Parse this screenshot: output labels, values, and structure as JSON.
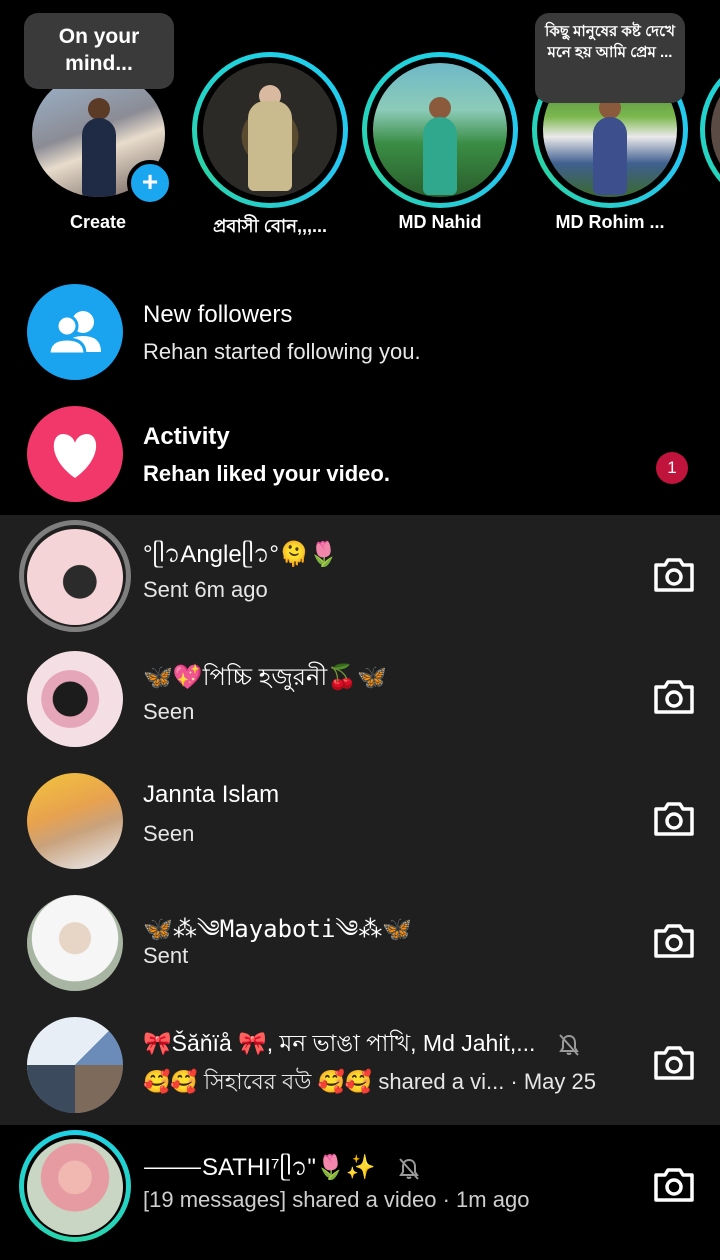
{
  "stories": [
    {
      "name": "Create",
      "bubble": "On your mind..."
    },
    {
      "name": "প্রবাসী বোন,,,..."
    },
    {
      "name": "MD Nahid"
    },
    {
      "name": "MD Rohim ...",
      "bubble": "কিছু মানুষের কষ্ট দেখে মনে হয় আমি প্রেম ..."
    }
  ],
  "notifications": [
    {
      "title": "New followers",
      "subtitle": "Rehan started following you.",
      "icon": "people-icon",
      "color": "#1aa3ef"
    },
    {
      "title": "Activity",
      "subtitle": "Rehan liked your video.",
      "icon": "heart-icon",
      "color": "#f2386b",
      "badge": "1"
    }
  ],
  "chats": [
    {
      "name": "°ᥫ᭡Angleᥫ᭡°🫠🌷",
      "meta": "Sent 6m ago"
    },
    {
      "name": "🦋💖পিচ্চি হজুরনী🍒🦋",
      "meta": "Seen"
    },
    {
      "name": "Jannta Islam",
      "meta": "Seen"
    },
    {
      "name": "🦋⁂༄Mayaboti༄⁂🦋",
      "meta": "Sent"
    },
    {
      "name": "🎀Šăňïå 🎀, মন ভাঙা পাখি, Md Jahit,...",
      "meta": "🥰🥰 সিহাবের বউ 🥰🥰 shared a vi... · May 25",
      "muted": true
    },
    {
      "name": "⸻SATHI⁷ᥫ᭡\"🌷✨",
      "meta": "[19 messages] shared a video · 1m ago",
      "muted": true
    }
  ],
  "colors": {
    "accent_blue": "#1aa7f0",
    "ring_teal": "#1fd1e8",
    "badge_red": "#c0143c",
    "heart_pink": "#f2386b"
  }
}
